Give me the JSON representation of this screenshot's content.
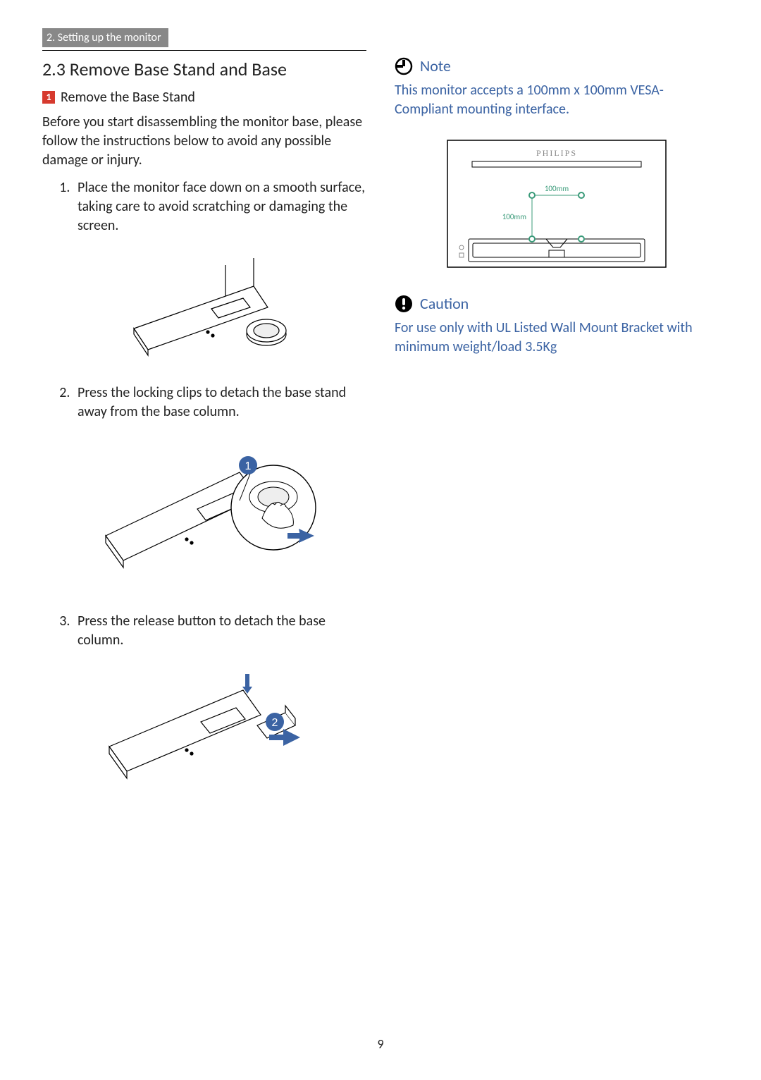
{
  "header_tag": "2. Setting up the monitor",
  "section_title": "2.3  Remove Base Stand and Base",
  "subhead_number": "1",
  "subhead_text": "Remove the Base Stand",
  "intro": "Before you start disassembling the monitor base, please follow the instructions below to avoid any possible damage or injury.",
  "steps": [
    "Place the monitor face down on a smooth surface, taking care to avoid scratching or damaging the screen.",
    "Press the locking clips to detach the base stand away from the base column.",
    "Press the release button to detach the base column."
  ],
  "note_label": "Note",
  "note_text": "This monitor accepts a 100mm x 100mm VESA-Compliant mounting interface.",
  "caution_label": "Caution",
  "caution_text": "For use only with UL Listed Wall Mount Bracket with minimum weight/load 3.5Kg",
  "vesa": {
    "h": "100mm",
    "v": "100mm",
    "brand": "PHILIPS"
  },
  "callout1": "1",
  "callout2": "2",
  "page_number": "9"
}
